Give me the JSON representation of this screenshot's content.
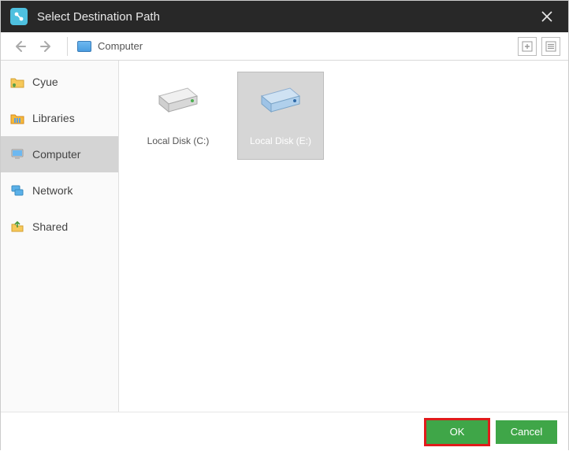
{
  "titlebar": {
    "title": "Select Destination Path"
  },
  "toolbar": {
    "location": "Computer"
  },
  "sidebar": {
    "items": [
      {
        "id": "cyue",
        "label": "Cyue",
        "icon": "user-folder-icon"
      },
      {
        "id": "libraries",
        "label": "Libraries",
        "icon": "libraries-icon"
      },
      {
        "id": "computer",
        "label": "Computer",
        "icon": "computer-icon",
        "selected": true
      },
      {
        "id": "network",
        "label": "Network",
        "icon": "network-icon"
      },
      {
        "id": "shared",
        "label": "Shared",
        "icon": "shared-icon"
      }
    ]
  },
  "content": {
    "drives": [
      {
        "id": "c",
        "label": "Local Disk (C:)",
        "color": "green",
        "selected": false
      },
      {
        "id": "e",
        "label": "Local Disk (E:)",
        "color": "blue",
        "selected": true
      }
    ]
  },
  "footer": {
    "ok_label": "OK",
    "cancel_label": "Cancel"
  }
}
